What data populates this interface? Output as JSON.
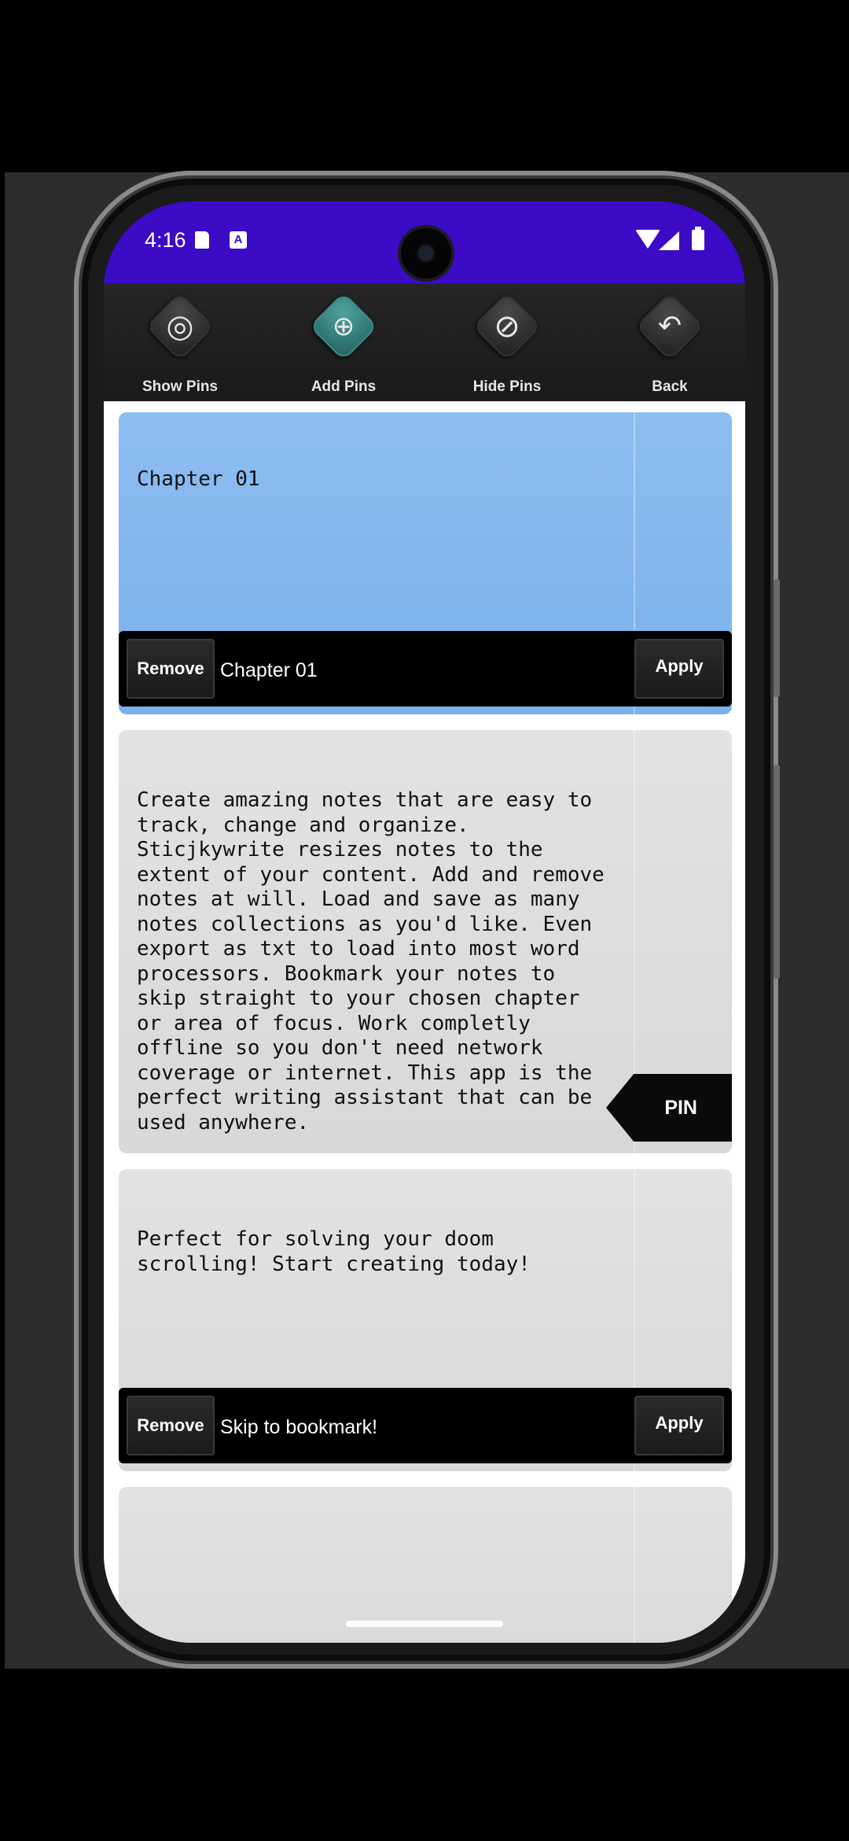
{
  "status_bar": {
    "time": "4:16",
    "icons": [
      "sd-card-icon",
      "a-icon",
      "wifi-icon",
      "cellular-icon",
      "battery-icon"
    ],
    "background": "#3c0bc6"
  },
  "toolbar": {
    "items": [
      {
        "label": "Show Pins",
        "icon": "target-icon",
        "active": false
      },
      {
        "label": "Add Pins",
        "icon": "add-pin-icon",
        "active": true
      },
      {
        "label": "Hide Pins",
        "icon": "no-symbol-icon",
        "active": false
      },
      {
        "label": "Back",
        "icon": "undo-arrow-icon",
        "active": false
      }
    ]
  },
  "notes": [
    {
      "text": "Chapter 01",
      "color": "#8dbdf0",
      "bookmark": {
        "remove_label": "Remove",
        "label": "Chapter 01",
        "apply_label": "Apply"
      }
    },
    {
      "text": "Create amazing notes that are easy to track, change and organize. Sticjkywrite resizes notes to the extent of your content. Add and remove notes at will. Load and save as many notes collections as you'd like. Even export as txt to load into most word processors. Bookmark your notes to skip straight to your chosen chapter or area of focus. Work completly offline so you don't need network coverage or internet. This app is the perfect writing assistant that can be used anywhere.",
      "color": "#dcdcdc",
      "pin_label": "PIN"
    },
    {
      "text": "Perfect for solving your doom scrolling! Start creating today!",
      "color": "#dcdcdc",
      "bookmark": {
        "remove_label": "Remove",
        "label": "Skip to bookmark!",
        "apply_label": "Apply"
      }
    },
    {
      "text": "",
      "color": "#dcdcdc"
    }
  ]
}
